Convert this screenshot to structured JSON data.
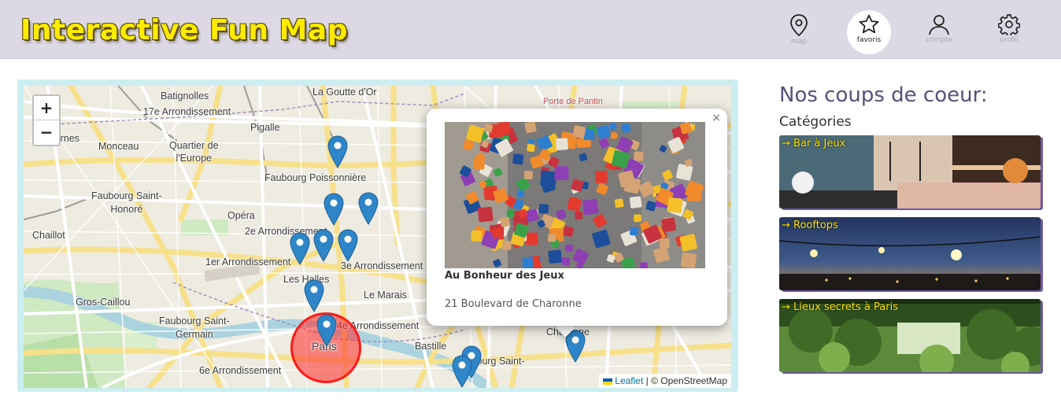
{
  "header": {
    "logo": "Interactive Fun Map",
    "nav": [
      {
        "label": "map",
        "icon": "map-pin-icon",
        "active": false
      },
      {
        "label": "favoris",
        "icon": "star-icon",
        "active": true
      },
      {
        "label": "compte",
        "icon": "user-icon",
        "active": false
      },
      {
        "label": "profil",
        "icon": "gear-icon",
        "active": false
      }
    ]
  },
  "map": {
    "zoom_in": "+",
    "zoom_out": "−",
    "places": {
      "batignolles": "Batignolles",
      "arr17": "17e Arrondissement",
      "goutte": "La Goutte d'Or",
      "pantin": "Porte de Pantin",
      "pigalle": "Pigalle",
      "ternes": "Les Ternes",
      "monceau": "Monceau",
      "europe": "Quartier de\nl'Europe",
      "poissonniere": "Faubourg Poissonnière",
      "fbsthonore": "Faubourg Saint-\nHonoré",
      "opera": "Opéra",
      "chaillot": "Chaillot",
      "arr2": "2e Arrondissement",
      "arr1": "1er Arrondissement",
      "arr3": "3e Arrondissement",
      "halles": "Les Halles",
      "marais": "Le Marais",
      "gros": "Gros-Caillou",
      "fbstgermain": "Faubourg Saint-\nGermain",
      "arr4": "4e Arrondissement",
      "paris": "Paris",
      "bastille": "Bastille",
      "fbsta": "Faubourg Saint-",
      "charonne": "Charonne",
      "arr6": "6e Arrondissement"
    },
    "attribution": {
      "leaflet": "Leaflet",
      "rest": " | © OpenStreetMap"
    },
    "popup": {
      "close": "×",
      "title": "Au Bonheur des Jeux",
      "address": "21 Boulevard de Charonne"
    },
    "colors": {
      "marker": "#2e86c8",
      "circle": "#ff1a1a"
    }
  },
  "sidebar": {
    "title": "Nos coups de coeur:",
    "subtitle": "Catégories",
    "categories": [
      {
        "label": "→ Bar à Jeux"
      },
      {
        "label": "→ Rooftops"
      },
      {
        "label": "→ Lieux secrets à Paris"
      }
    ]
  }
}
